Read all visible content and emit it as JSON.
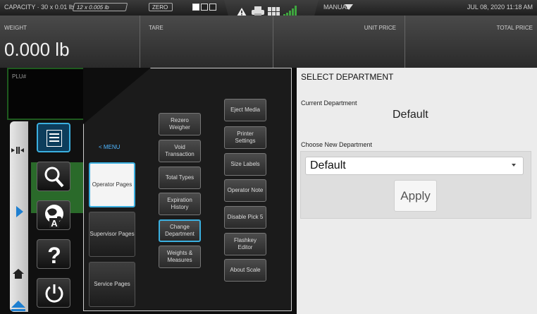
{
  "status_bar": {
    "capacity": "CAPACITY · 30 x 0.01 lb",
    "increment": "12 x 0.005 lb",
    "zero": "ZERO",
    "mode": "MANUAL",
    "datetime": "JUL 08, 2020 11:18 AM"
  },
  "readouts": {
    "weight_label": "WEIGHT",
    "weight_value": "0.000 lb",
    "tare_label": "TARE",
    "unit_price_label": "UNIT PRICE",
    "total_price_label": "TOTAL PRICE",
    "plu_label": "PLU#"
  },
  "menu": {
    "back_label": "< MENU",
    "pages": [
      {
        "label": "Operator Pages",
        "selected": true
      },
      {
        "label": "Supervisor Pages",
        "selected": false
      },
      {
        "label": "Service Pages",
        "selected": false
      }
    ],
    "col1": [
      "Rezero Weigher",
      "Void Transaction",
      "Total Types",
      "Expiration History",
      "Change Department",
      "Weights & Measures"
    ],
    "col2": [
      "Eject Media",
      "Printer Settings",
      "Size Labels",
      "Operator Note",
      "Disable Pick 5",
      "Flashkey Editor",
      "About Scale"
    ],
    "active_item": "Change Department"
  },
  "side_icons": [
    "list-icon",
    "search-icon",
    "globe-language-icon",
    "help-icon",
    "power-icon"
  ],
  "dialog": {
    "title": "SELECT DEPARTMENT",
    "current_label": "Current Department",
    "current_value": "Default",
    "choose_label": "Choose New Department",
    "selected_option": "Default",
    "apply_label": "Apply"
  },
  "colors": {
    "accent": "#3bb0e0",
    "plu_border": "#1e5a1e",
    "dialog_bg": "#ececec"
  }
}
